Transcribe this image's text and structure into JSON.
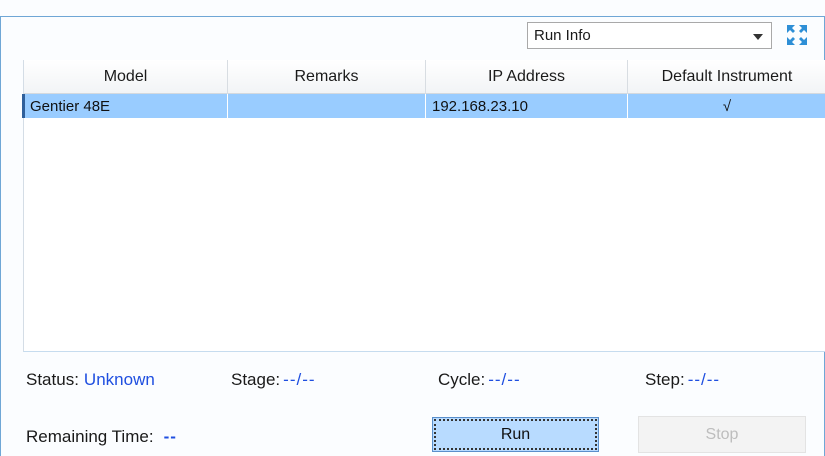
{
  "header": {
    "view_select": {
      "value": "Run Info"
    },
    "expand_icon": "expand-arrows-icon"
  },
  "table": {
    "columns": [
      "Model",
      "Remarks",
      "IP Address",
      "Default Instrument"
    ],
    "rows": [
      {
        "model": "Gentier 48E",
        "remarks": "",
        "ip": "192.168.23.10",
        "default": "√",
        "selected": true
      }
    ]
  },
  "status": {
    "status_label": "Status:",
    "status_value": "Unknown",
    "stage_label": "Stage:",
    "stage_value": "--/--",
    "cycle_label": "Cycle:",
    "cycle_value": "--/--",
    "step_label": "Step:",
    "step_value": "--/--",
    "remaining_label": "Remaining Time:",
    "remaining_value": "--"
  },
  "buttons": {
    "run": "Run",
    "stop": "Stop"
  },
  "colors": {
    "accent_blue": "#1f4fe0",
    "selected_row": "#99ccff",
    "run_button": "#b8dbff"
  }
}
